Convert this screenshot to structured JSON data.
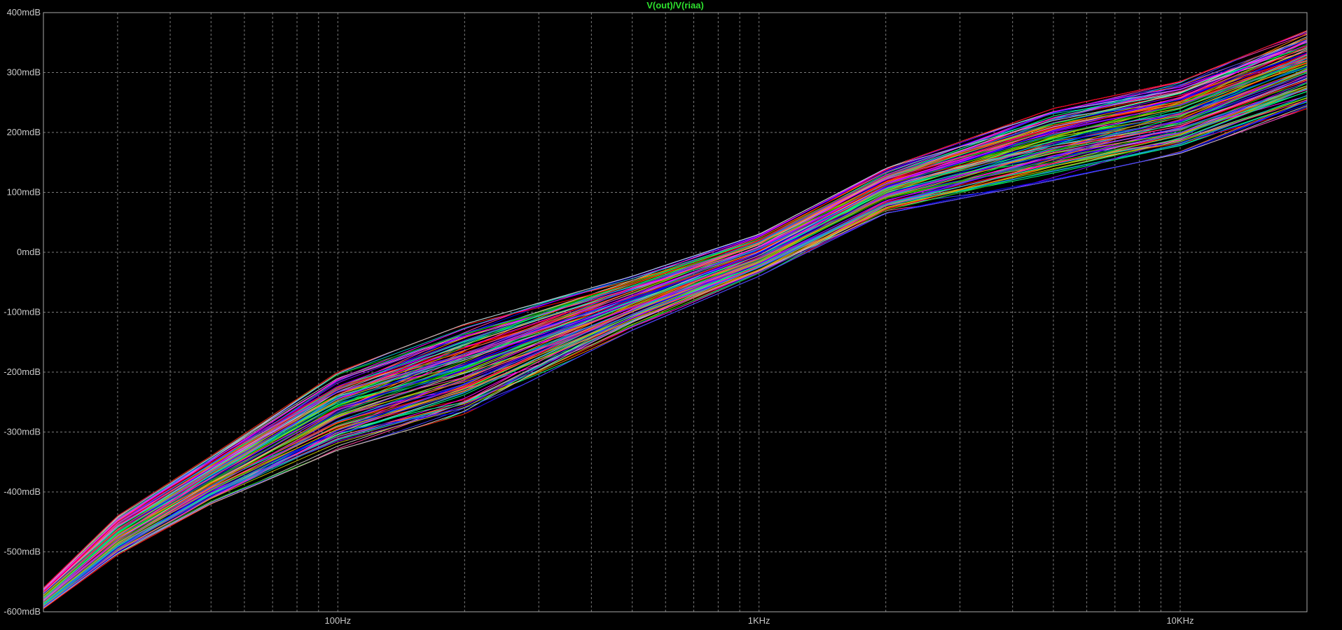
{
  "window": {
    "background_color": "#000000",
    "grid_color": "#7a7a7a",
    "frame_color": "#a9a9a9",
    "tick_label_color": "#c8c8c8"
  },
  "chart_data": {
    "type": "line",
    "title": "V(out)/V(riaa)",
    "title_color": "#2ee02e",
    "x_scale": "log",
    "xlim": [
      20,
      20000
    ],
    "ylim": [
      -600,
      400
    ],
    "y_unit": "mdB",
    "grid": true,
    "x_ticks": [
      {
        "value": 100,
        "label": "100Hz"
      },
      {
        "value": 1000,
        "label": "1KHz"
      },
      {
        "value": 10000,
        "label": "10KHz"
      }
    ],
    "y_ticks": [
      {
        "value": 400,
        "label": "400mdB"
      },
      {
        "value": 300,
        "label": "300mdB"
      },
      {
        "value": 200,
        "label": "200mdB"
      },
      {
        "value": 100,
        "label": "100mdB"
      },
      {
        "value": 0,
        "label": "0mdB"
      },
      {
        "value": -100,
        "label": "-100mdB"
      },
      {
        "value": -200,
        "label": "-200mdB"
      },
      {
        "value": -300,
        "label": "-300mdB"
      },
      {
        "value": -400,
        "label": "-400mdB"
      },
      {
        "value": -500,
        "label": "-500mdB"
      },
      {
        "value": -600,
        "label": "-600mdB"
      }
    ],
    "trace_count": 120,
    "trace_colors": [
      "#ff00ff",
      "#0000ff",
      "#00c000",
      "#ff0000",
      "#00c0c0",
      "#c0c000",
      "#8000ff",
      "#ff8000",
      "#00ff80",
      "#c0c0c0",
      "#ff40a0",
      "#4040ff"
    ],
    "envelope": {
      "frequencies": [
        20,
        30,
        50,
        100,
        200,
        500,
        1000,
        2000,
        5000,
        10000,
        20000
      ],
      "upper": [
        -560,
        -440,
        -340,
        -200,
        -120,
        -40,
        30,
        140,
        240,
        285,
        370
      ],
      "lower": [
        -595,
        -505,
        -420,
        -330,
        -270,
        -130,
        -40,
        65,
        120,
        165,
        240
      ]
    }
  }
}
